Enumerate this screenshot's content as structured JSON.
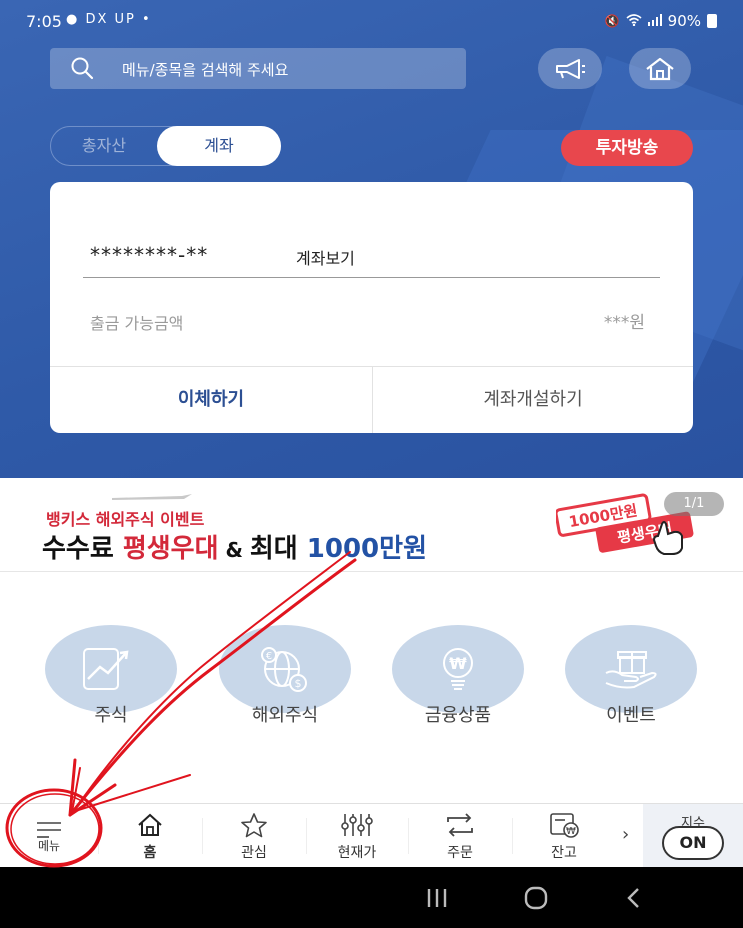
{
  "status_bar": {
    "time": "7:05",
    "left_icons": "● DX UP •",
    "battery": "90%"
  },
  "search": {
    "placeholder": "메뉴/종목을 검색해 주세요"
  },
  "header_buttons": [
    {
      "icon": "megaphone-icon"
    },
    {
      "icon": "home-icon"
    }
  ],
  "segment": {
    "tabs": [
      "총자산",
      "계좌"
    ],
    "selected": "계좌"
  },
  "broadcast_button": "투자방송",
  "account_card": {
    "account_number": "********-**",
    "view_link": "계좌보기",
    "available_label": "출금 가능금액",
    "available_value": "***원",
    "actions": [
      "이체하기",
      "계좌개설하기"
    ]
  },
  "banner": {
    "subtitle": "뱅키스 해외주식 이벤트",
    "title_part1": "수수료 ",
    "title_highlight": "평생우대",
    "title_amp": " & ",
    "title_part2": "최대 ",
    "title_amount": "1000만원",
    "badge_text_1": "1000만원",
    "badge_text_2": "평생우대",
    "page_indicator": "1/1"
  },
  "quick_menu": [
    {
      "label": "주식",
      "icon": "stock-chart-icon"
    },
    {
      "label": "해외주식",
      "icon": "globe-currency-icon"
    },
    {
      "label": "금융상품",
      "icon": "lightbulb-won-icon"
    },
    {
      "label": "이벤트",
      "icon": "gift-hand-icon"
    }
  ],
  "bottom_nav": {
    "items": [
      {
        "label": "메뉴",
        "icon": "menu-icon"
      },
      {
        "label": "홈",
        "icon": "home-icon"
      },
      {
        "label": "관심",
        "icon": "star-icon"
      },
      {
        "label": "현재가",
        "icon": "price-sliders-icon"
      },
      {
        "label": "주문",
        "icon": "order-arrows-icon"
      },
      {
        "label": "잔고",
        "icon": "balance-icon"
      }
    ],
    "index_label": "지수",
    "index_toggle": "ON"
  },
  "colors": {
    "primary_blue": "#2f5aa8",
    "broadcast_red": "#e8474d",
    "annotation_red": "#e0141e"
  }
}
